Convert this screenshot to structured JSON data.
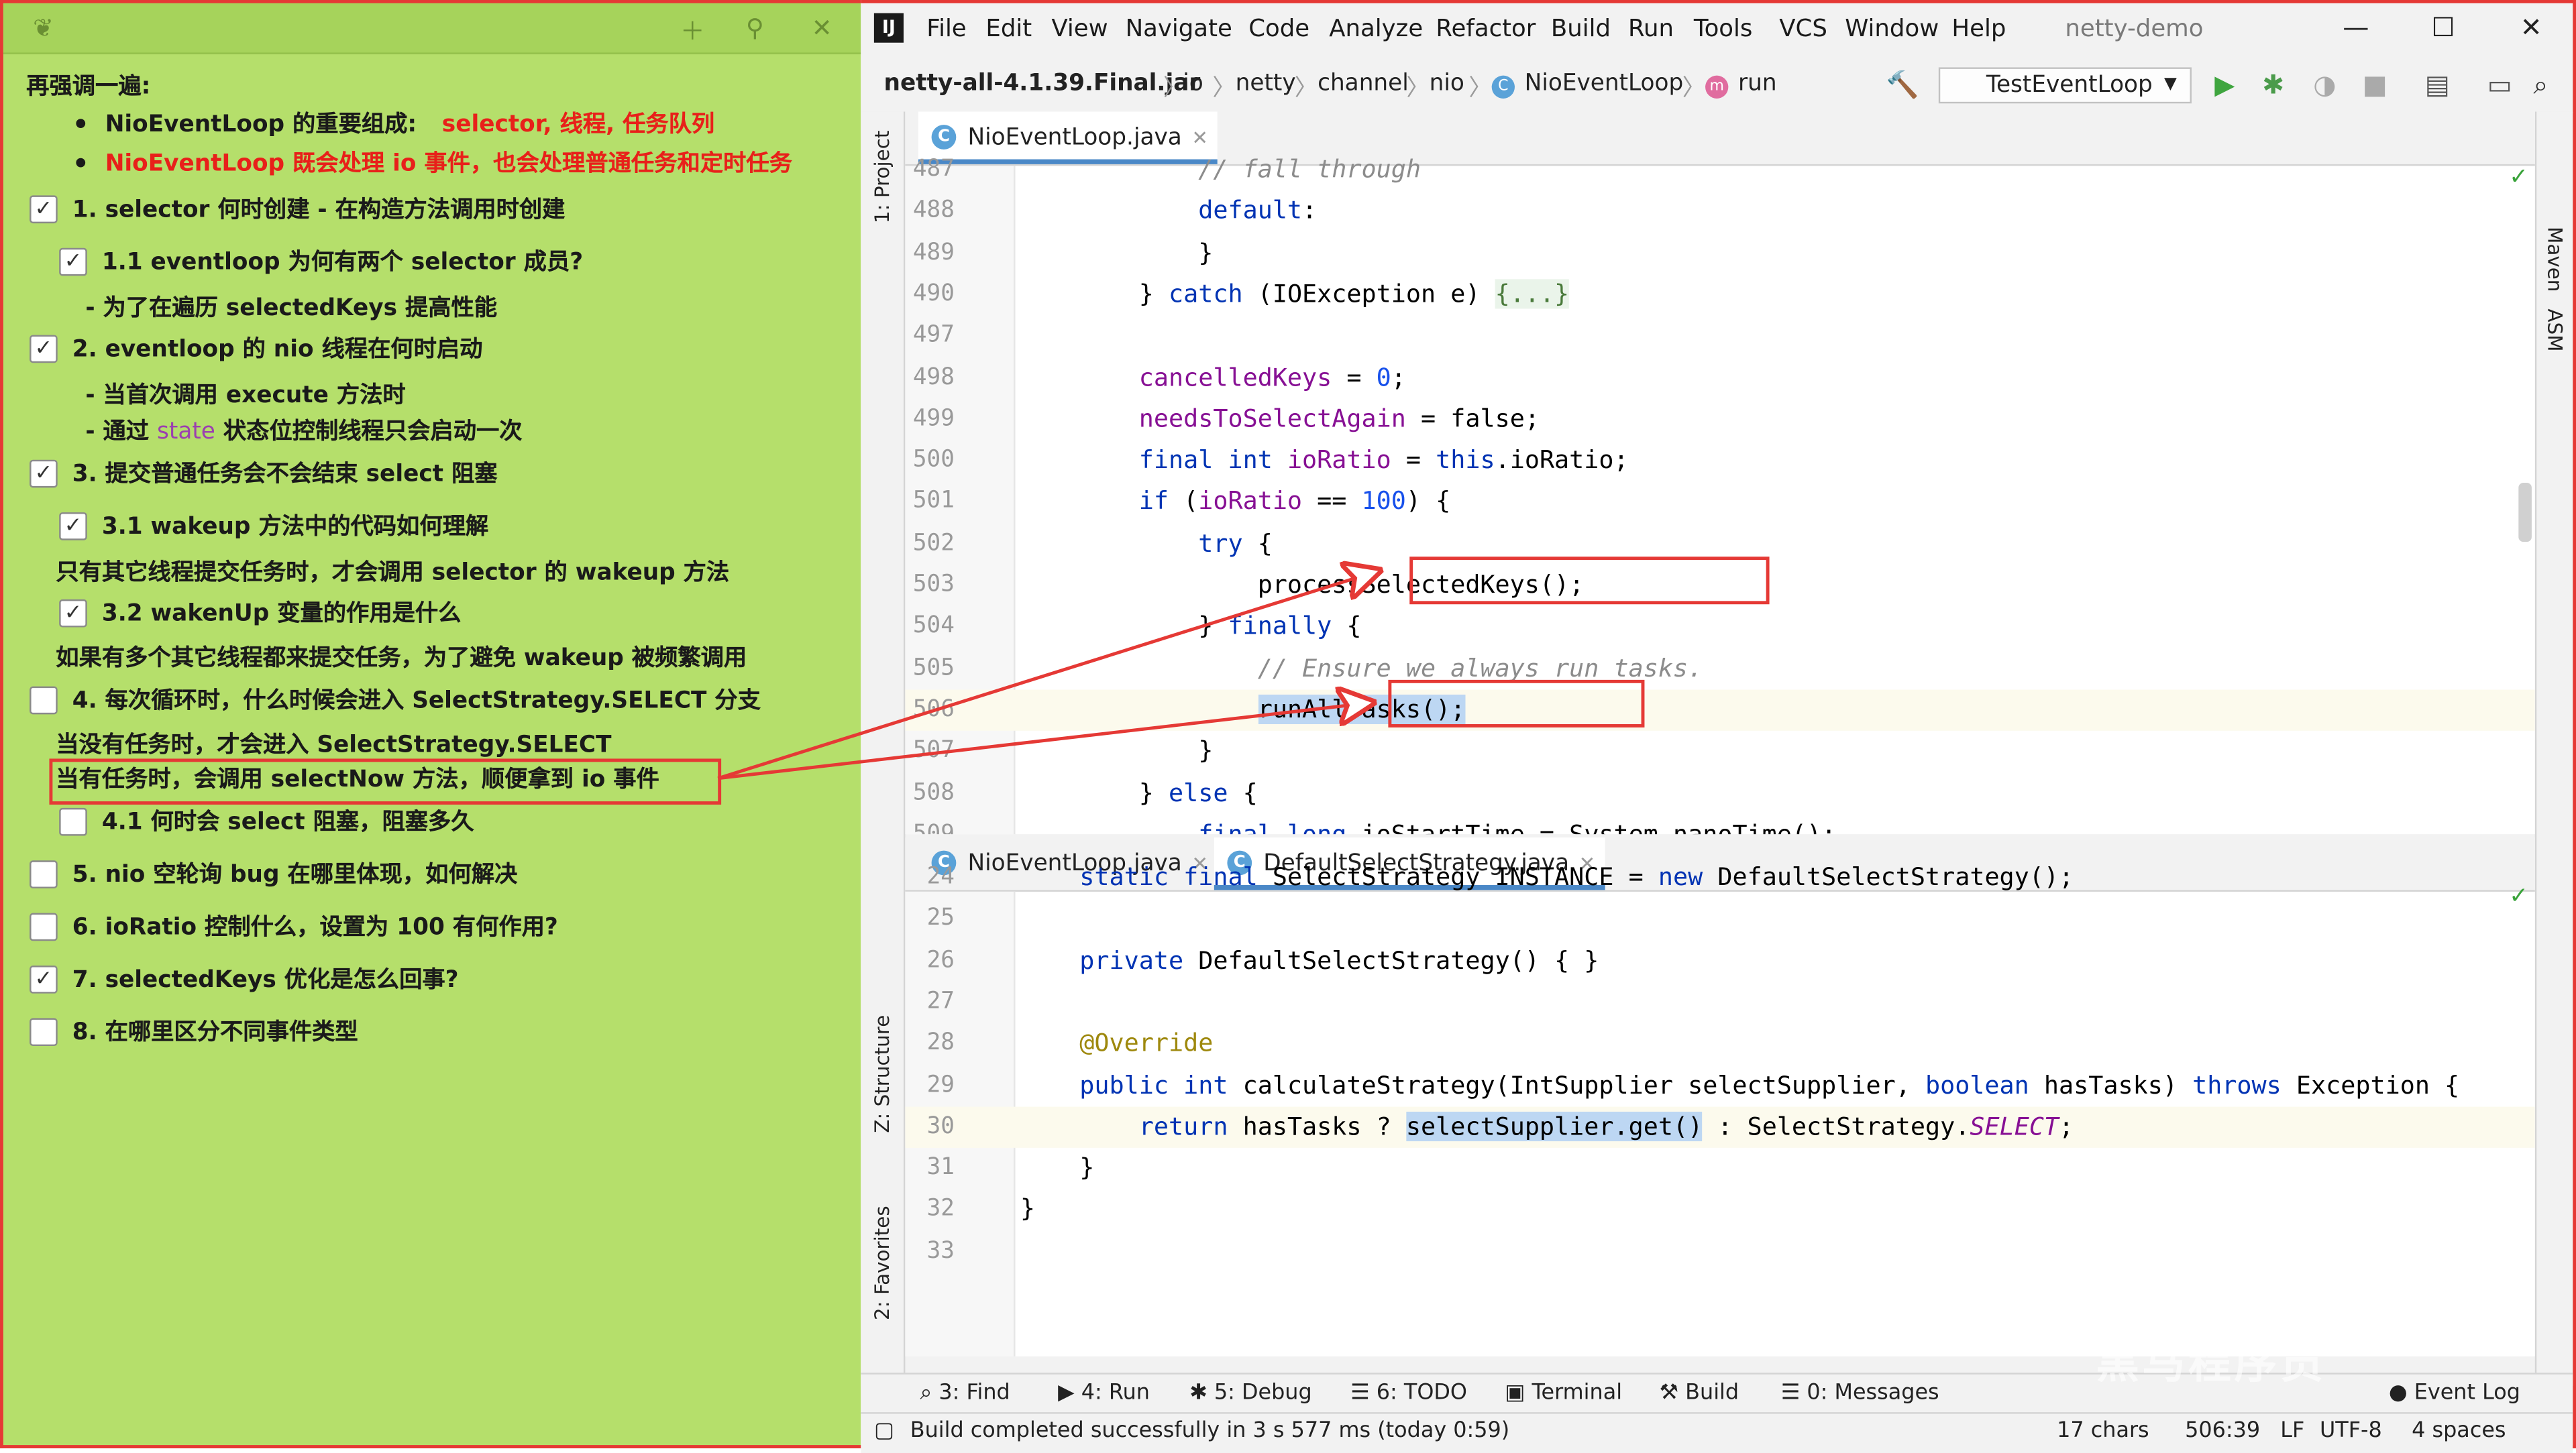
{
  "notes": {
    "heading": "再强调一遍:",
    "bullets": [
      {
        "prefix": "NioEventLoop 的重要组成:",
        "highlight": "selector, 线程, 任务队列"
      },
      {
        "prefix": "",
        "highlight": "NioEventLoop 既会处理 io 事件，也会处理普通任务和定时任务"
      }
    ],
    "items": [
      {
        "text": "1. selector 何时创建 - 在构造方法调用时创建",
        "checked": true
      },
      {
        "text": "1.1 eventloop 为何有两个 selector 成员?",
        "checked": true
      },
      {
        "text": "- 为了在遍历 selectedKeys 提高性能"
      },
      {
        "text": "2. eventloop 的 nio 线程在何时启动",
        "checked": true
      },
      {
        "text": "- 当首次调用  execute 方法时"
      },
      {
        "text_a": "- 通过 ",
        "text_purple": "state",
        "text_b": " 状态位控制线程只会启动一次"
      },
      {
        "text": "3. 提交普通任务会不会结束 select 阻塞",
        "checked": true
      },
      {
        "text": "3.1 wakeup 方法中的代码如何理解",
        "checked": true
      },
      {
        "text": "只有其它线程提交任务时，才会调用 selector 的 wakeup 方法"
      },
      {
        "text": "3.2 wakenUp 变量的作用是什么",
        "checked": true
      },
      {
        "text": "如果有多个其它线程都来提交任务，为了避免 wakeup 被频繁调用"
      },
      {
        "text": "4. 每次循环时，什么时候会进入 SelectStrategy.SELECT 分支",
        "checked": false
      },
      {
        "text": "当没有任务时，才会进入 SelectStrategy.SELECT"
      },
      {
        "text": "当有任务时，会调用 selectNow 方法，顺便拿到 io 事件"
      },
      {
        "text": "4.1 何时会 select 阻塞，阻塞多久",
        "checked": false
      },
      {
        "text": "5. nio 空轮询 bug 在哪里体现，如何解决",
        "checked": false
      },
      {
        "text": "6. ioRatio 控制什么，设置为 100 有何作用?",
        "checked": false
      },
      {
        "text": "7. selectedKeys 优化是怎么回事?",
        "checked": true
      },
      {
        "text": "8. 在哪里区分不同事件类型",
        "checked": false
      }
    ]
  },
  "ide": {
    "menu": [
      "File",
      "Edit",
      "View",
      "Navigate",
      "Code",
      "Analyze",
      "Refactor",
      "Build",
      "Run",
      "Tools",
      "VCS",
      "Window",
      "Help"
    ],
    "project_title": "netty-demo",
    "breadcrumbs": [
      "netty-all-4.1.39.Final.jar",
      "io",
      "netty",
      "channel",
      "nio",
      "NioEventLoop",
      "run"
    ],
    "run_config": "TestEventLoop",
    "left_tabs": [
      "1: Project",
      "Z: Structure",
      "2: Favorites"
    ],
    "right_tabs": [
      "Maven",
      "ASM"
    ],
    "top_editor": {
      "tabs": [
        "NioEventLoop.java"
      ],
      "lines": [
        {
          "n": "487",
          "code": "            // fall through"
        },
        {
          "n": "488",
          "code": "            default:"
        },
        {
          "n": "489",
          "code": "            }"
        },
        {
          "n": "490",
          "code": "        } catch (IOException e) {...}"
        },
        {
          "n": "497",
          "code": ""
        },
        {
          "n": "498",
          "code": "        cancelledKeys = 0;"
        },
        {
          "n": "499",
          "code": "        needsToSelectAgain = false;"
        },
        {
          "n": "500",
          "code": "        final int ioRatio = this.ioRatio;"
        },
        {
          "n": "501",
          "code": "        if (ioRatio == 100) {"
        },
        {
          "n": "502",
          "code": "            try {"
        },
        {
          "n": "503",
          "code": "                processSelectedKeys();"
        },
        {
          "n": "504",
          "code": "            } finally {"
        },
        {
          "n": "505",
          "code": "                // Ensure we always run tasks."
        },
        {
          "n": "506",
          "code": "                runAllTasks();"
        },
        {
          "n": "507",
          "code": "            }"
        },
        {
          "n": "508",
          "code": "        } else {"
        },
        {
          "n": "509",
          "code": "            final long ioStartTime = System.nanoTime();"
        }
      ]
    },
    "bottom_editor": {
      "tabs": [
        "NioEventLoop.java",
        "DefaultSelectStrategy.java"
      ],
      "lines": [
        {
          "n": "24",
          "code": "    static final SelectStrategy INSTANCE = new DefaultSelectStrategy();"
        },
        {
          "n": "25",
          "code": ""
        },
        {
          "n": "26",
          "code": "    private DefaultSelectStrategy() { }"
        },
        {
          "n": "27",
          "code": ""
        },
        {
          "n": "28",
          "code": "    @Override"
        },
        {
          "n": "29",
          "code": "    public int calculateStrategy(IntSupplier selectSupplier, boolean hasTasks) throws Exception {"
        },
        {
          "n": "30",
          "code": "        return hasTasks ? selectSupplier.get() : SelectStrategy.SELECT;"
        },
        {
          "n": "31",
          "code": "    }"
        },
        {
          "n": "32",
          "code": "}"
        },
        {
          "n": "33",
          "code": ""
        }
      ]
    },
    "bottom_tools": [
      "3: Find",
      "4: Run",
      "5: Debug",
      "6: TODO",
      "Terminal",
      "Build",
      "0: Messages",
      "Event Log"
    ],
    "status": {
      "message": "Build completed successfully in 3 s 577 ms (today 0:59)",
      "chars": "17 chars",
      "position": "506:39",
      "line_sep": "LF",
      "encoding": "UTF-8",
      "indent": "4 spaces"
    },
    "watermark": "黑马程序员"
  },
  "colors": {
    "note_bg": "#b5df6b",
    "highlight_red": "#e53935",
    "keyword": "#0033b3",
    "field": "#871094"
  }
}
